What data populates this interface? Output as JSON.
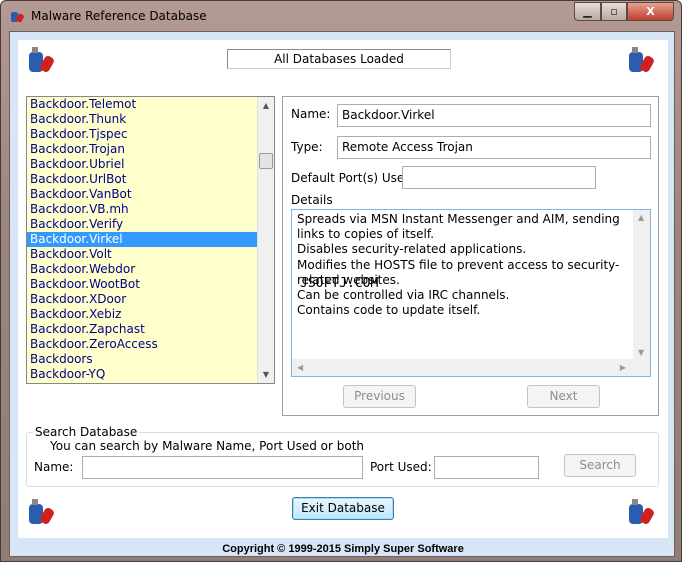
{
  "window": {
    "title": "Malware Reference Database",
    "minimize": "minimize",
    "maximize": "maximize",
    "close": "close"
  },
  "status": "All Databases Loaded",
  "list": {
    "items": [
      "Backdoor.Telemot",
      "Backdoor.Thunk",
      "Backdoor.Tjspec",
      "Backdoor.Trojan",
      "Backdoor.Ubriel",
      "Backdoor.UrlBot",
      "Backdoor.VanBot",
      "Backdoor.VB.mh",
      "Backdoor.Verify",
      "Backdoor.Virkel",
      "Backdoor.Volt",
      "Backdoor.Webdor",
      "Backdoor.WootBot",
      "Backdoor.XDoor",
      "Backdoor.Xebiz",
      "Backdoor.Zapchast",
      "Backdoor.ZeroAccess",
      "Backdoors",
      "Backdoor-YQ"
    ],
    "selected": "Backdoor.Virkel"
  },
  "detail": {
    "name_label": "Name:",
    "name_value": "Backdoor.Virkel",
    "type_label": "Type:",
    "type_value": "Remote Access Trojan",
    "port_label": "Default Port(s) Used:",
    "port_value": "",
    "details_label": "Details",
    "details_lines": [
      "Spreads via MSN Instant Messenger and AIM, sending links to copies of itself.",
      "Disables security-related applications.",
      "Modifies the HOSTS file to prevent access to security-related websites.",
      "Can be controlled via IRC channels.",
      "Contains code to update itself."
    ],
    "watermark": "JSOFTJ.COM",
    "previous_label": "Previous",
    "next_label": "Next"
  },
  "search": {
    "group_label": "Search Database",
    "hint": "You can search by Malware Name, Port Used or both",
    "name_label": "Name:",
    "name_value": "",
    "port_label": "Port Used:",
    "port_value": "",
    "button": "Search"
  },
  "exit_button": "Exit Database",
  "copyright": "Copyright © 1999-2015 Simply Super Software",
  "colors": {
    "list_bg": "#ffffcc",
    "list_text": "#00008b",
    "selection": "#3399ff",
    "frame": "#d6e6f6"
  }
}
